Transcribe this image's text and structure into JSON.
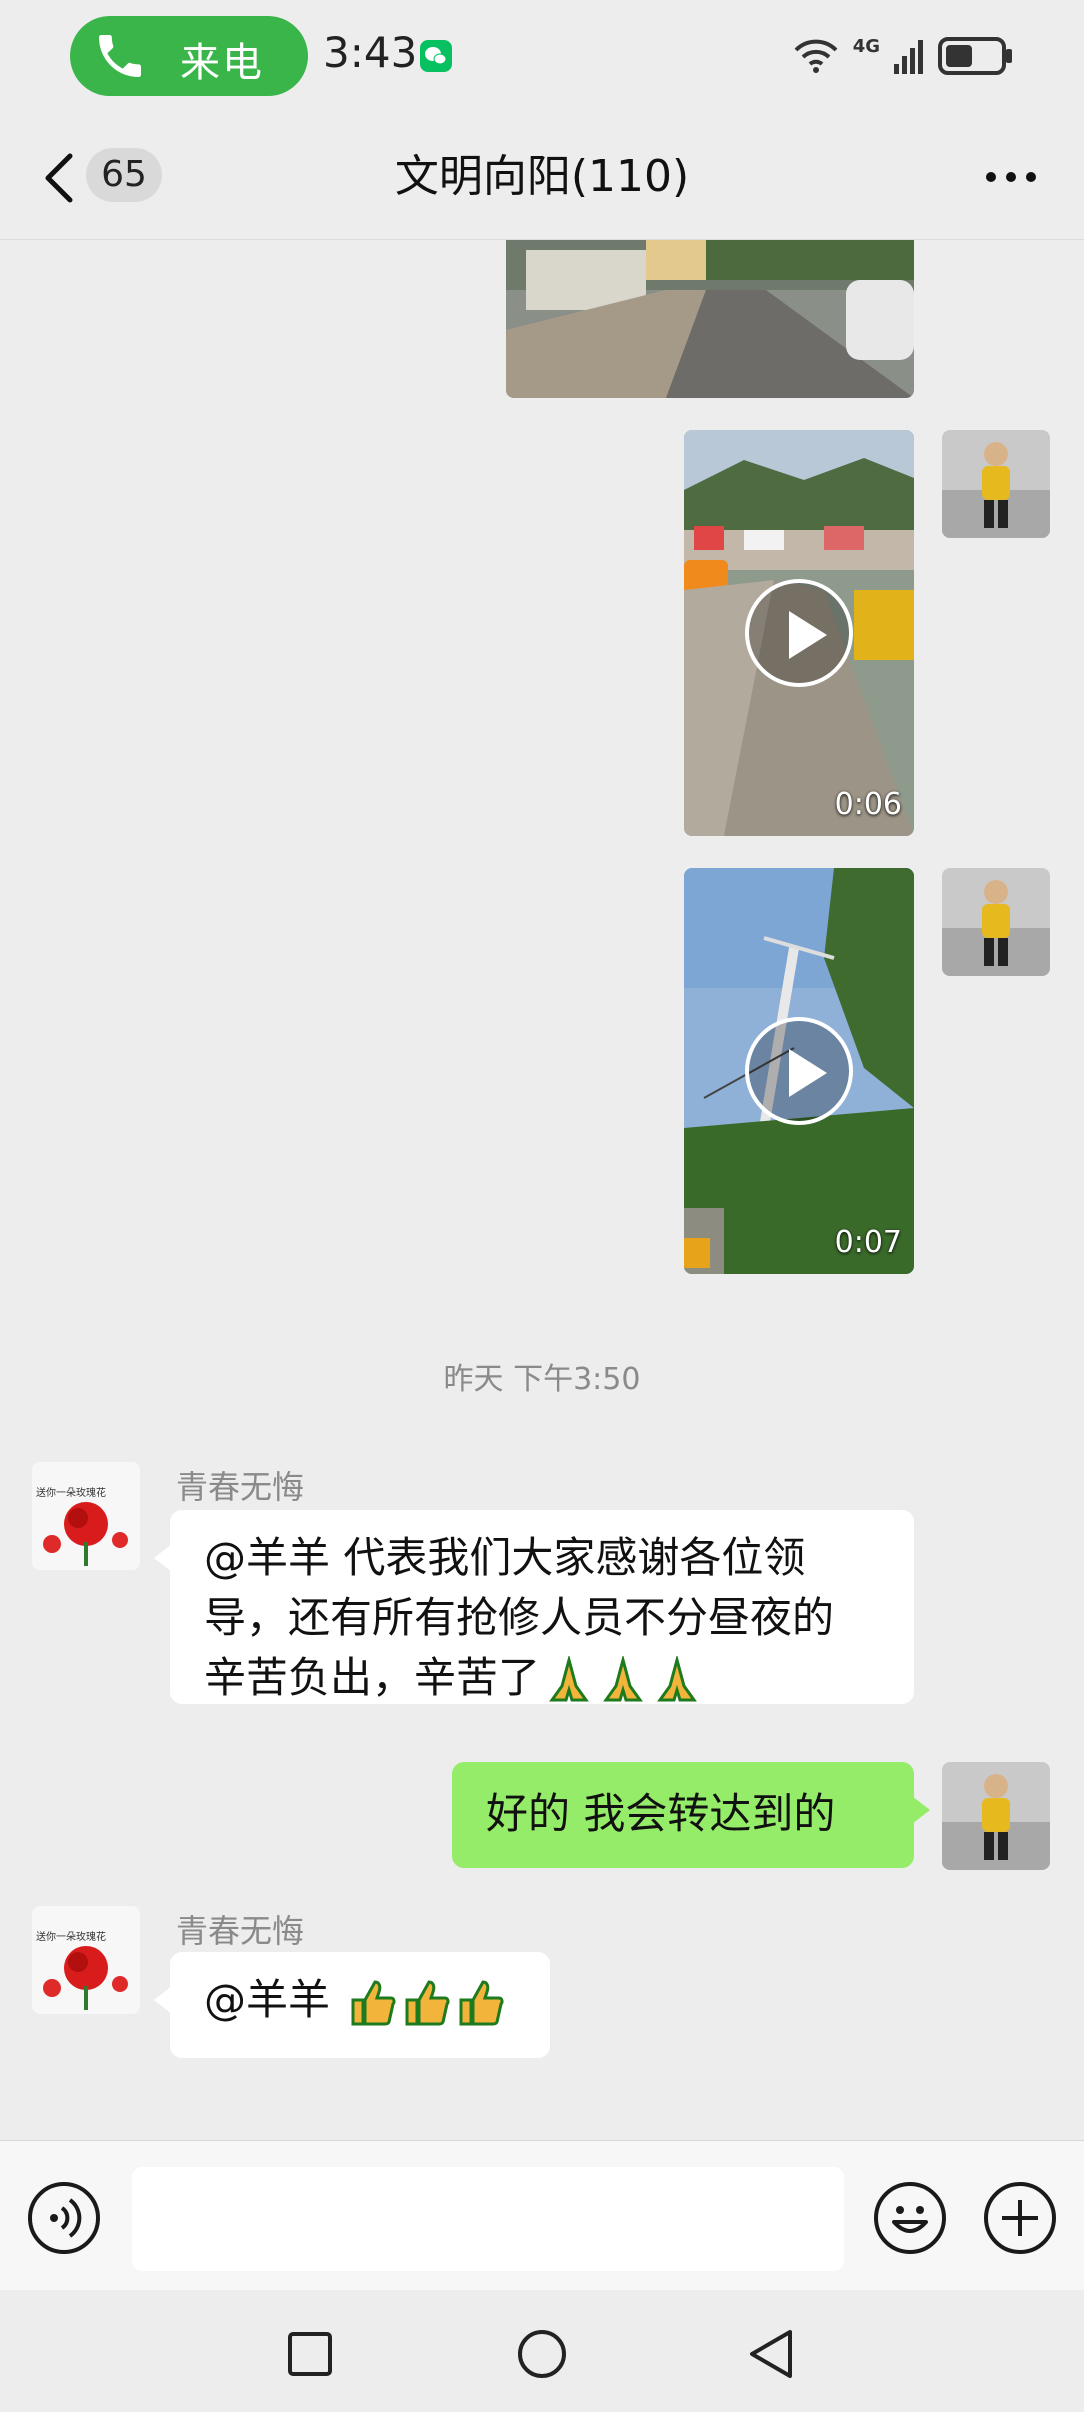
{
  "status_bar": {
    "call_label": "来电",
    "time": "3:43",
    "network": "4G"
  },
  "header": {
    "unread_count": "65",
    "title": "文明向阳(110)"
  },
  "messages": {
    "video1_duration": "0:06",
    "video2_duration": "0:07",
    "timestamp": "昨天 下午3:50",
    "msg1": {
      "sender": "青春无悔",
      "line1": "@羊羊  代表我们大家感谢各位领",
      "line2": "导，还有所有抢修人员不分昼夜的",
      "line3": "辛苦负出，辛苦了"
    },
    "msg2": {
      "text": "好的   我会转达到的"
    },
    "msg3": {
      "sender": "青春无悔",
      "text": "@羊羊 "
    },
    "avatar_caption": "送你一朵玫瑰花"
  },
  "colors": {
    "accent_green": "#95ec69",
    "call_green": "#39b54a",
    "background": "#ededed"
  }
}
